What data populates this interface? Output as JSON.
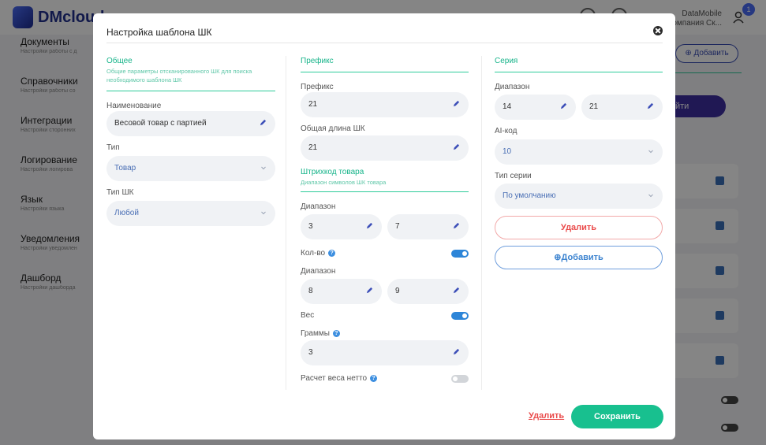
{
  "app": {
    "logo_text": "DMcloud",
    "user_line1": "DataMobile",
    "user_line2": "Компания Ск...",
    "notification_count": "1",
    "add_button": "⊕ Добавить",
    "purple_button": "йти"
  },
  "sidebar": {
    "items": [
      {
        "title": "Документы",
        "sub": "Настройки работы с д"
      },
      {
        "title": "Справочники",
        "sub": "Настройки работы со"
      },
      {
        "title": "Интеграции",
        "sub": "Настройки сторонних"
      },
      {
        "title": "Логирование",
        "sub": "Настройки логирова"
      },
      {
        "title": "Язык",
        "sub": "Настройки языка"
      },
      {
        "title": "Уведомления",
        "sub": "Настройки уведомлен"
      },
      {
        "title": "Дашборд",
        "sub": "Настройки дашборда"
      }
    ]
  },
  "modal": {
    "title": "Настройка шаблона ШК",
    "general": {
      "title": "Общее",
      "subtitle": "Общие параметры отсканированного ШК для поиска необходимого шаблона ШК",
      "name_label": "Наименование",
      "name_value": "Весовой товар с партией",
      "type_label": "Тип",
      "type_value": "Товар",
      "barcode_type_label": "Тип ШК",
      "barcode_type_value": "Любой"
    },
    "prefix": {
      "title": "Префикс",
      "prefix_label": "Префикс",
      "prefix_value": "21",
      "length_label": "Общая длина ШК",
      "length_value": "21",
      "barcode_title": "Штрихкод товара",
      "barcode_subtitle": "Диапазон символов ШК товара",
      "range_label": "Диапазон",
      "range_from": "3",
      "range_to": "7",
      "qty_label": "Кол-во",
      "qty_enabled": true,
      "qty_range_label": "Диапазон",
      "qty_range_from": "8",
      "qty_range_to": "9",
      "weight_label": "Вес",
      "weight_enabled": true,
      "grams_label": "Граммы",
      "grams_value": "3",
      "net_weight_label": "Расчет веса нетто",
      "net_weight_enabled": false
    },
    "series": {
      "title": "Серия",
      "range_label": "Диапазон",
      "range_from": "14",
      "range_to": "21",
      "ai_label": "AI-код",
      "ai_value": "10",
      "series_type_label": "Тип серии",
      "series_type_value": "По умолчанию",
      "delete_button": "Удалить",
      "add_button": "⊕Добавить"
    },
    "footer": {
      "delete_link": "Удалить",
      "save_button": "Сохранить"
    }
  },
  "colors": {
    "accent_green": "#18c08f",
    "toggle_on": "#2d85d8",
    "danger": "#ea4b4b"
  }
}
